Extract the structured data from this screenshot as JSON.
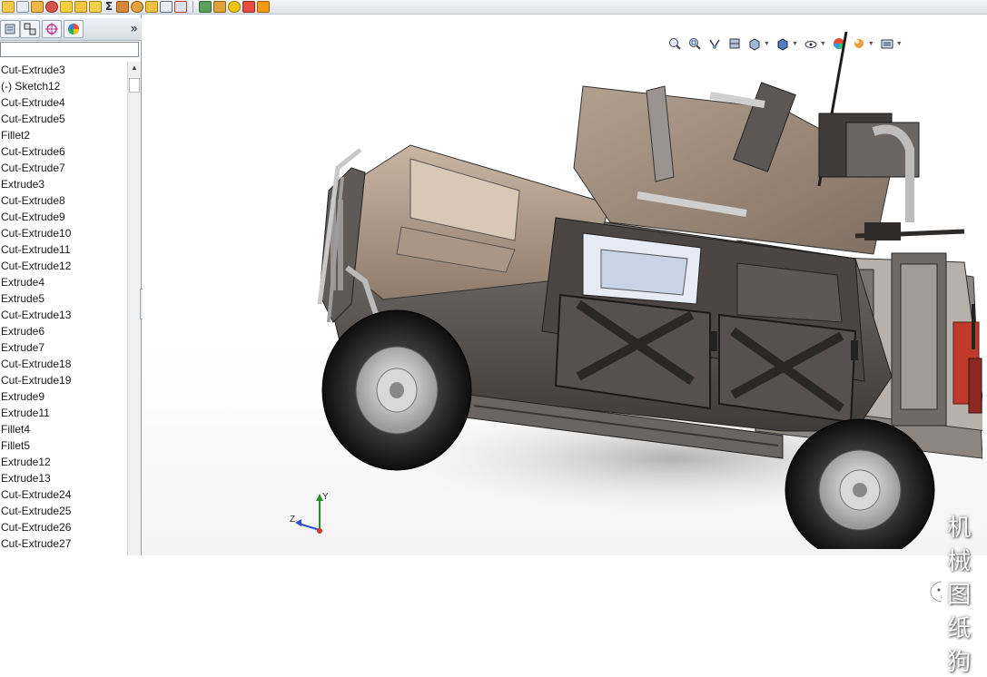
{
  "toolbar": {
    "icons": [
      "sketch-icon",
      "smart-dimension-icon",
      "extrude-icon",
      "revolve-icon",
      "check-icon",
      "rebuild-icon",
      "options-icon",
      "sigma-icon",
      "weld-icon",
      "measure-icon",
      "section-icon",
      "select-icon",
      "reference-icon",
      "pattern-icon",
      "edit-appearance-icon",
      "scene-icon",
      "realview-icon",
      "photoview-icon"
    ],
    "sigma": "Σ"
  },
  "panel": {
    "tabs": [
      "feature-manager-tab",
      "property-manager-tab",
      "configuration-manager-tab",
      "display-manager-tab"
    ],
    "expand_glyph": "»",
    "tree_items": [
      "Cut-Extrude3",
      "(-) Sketch12",
      "Cut-Extrude4",
      "Cut-Extrude5",
      "Fillet2",
      "Cut-Extrude6",
      "Cut-Extrude7",
      "Extrude3",
      "Cut-Extrude8",
      "Cut-Extrude9",
      "Cut-Extrude10",
      "Cut-Extrude11",
      "Cut-Extrude12",
      "Extrude4",
      "Extrude5",
      "Cut-Extrude13",
      "Extrude6",
      "Extrude7",
      "Cut-Extrude18",
      "Cut-Extrude19",
      "Extrude9",
      "Extrude11",
      "Fillet4",
      "Fillet5",
      "Extrude12",
      "Extrude13",
      "Cut-Extrude24",
      "Cut-Extrude25",
      "Cut-Extrude26",
      "Cut-Extrude27"
    ]
  },
  "heads_up": [
    "zoom-to-fit-icon",
    "zoom-to-area-icon",
    "previous-view-icon",
    "section-view-icon",
    "view-orientation-icon",
    "display-style-icon",
    "hide-show-items-icon",
    "edit-appearance-icon",
    "apply-scene-icon",
    "view-settings-icon"
  ],
  "triad": {
    "y": "Y",
    "z": "Z"
  },
  "watermark": {
    "text": "机械图纸狗"
  },
  "colors": {
    "body_tan": "#a89482",
    "body_dark": "#5a5350",
    "tire": "#1f1f1f",
    "rim": "#cfcfcf",
    "accent_red": "#c0392b",
    "panel_border": "#8f9aa6"
  }
}
